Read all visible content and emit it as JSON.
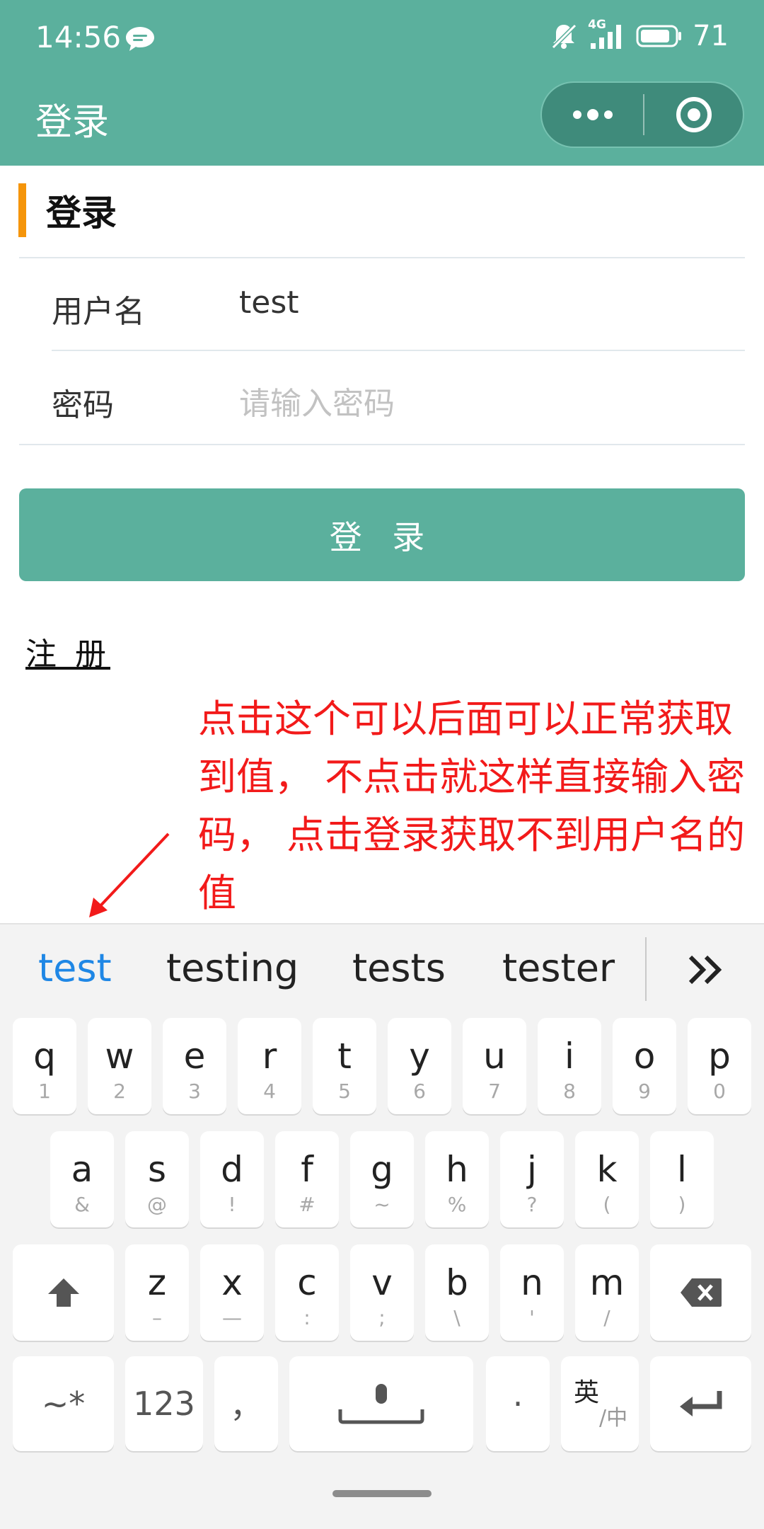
{
  "status_bar": {
    "time": "14:56",
    "signal_label": "4G",
    "battery": "71"
  },
  "nav": {
    "title": "登录"
  },
  "form": {
    "section_title": "登录",
    "username_label": "用户名",
    "username_value": "test",
    "password_label": "密码",
    "password_placeholder": "请输入密码",
    "login_button": "登 录",
    "register_link": "注 册"
  },
  "annotation": {
    "text": "点击这个可以后面可以正常获取到值， 不点击就这样直接输入密码， 点击登录获取不到用户名的值",
    "color": "#f21a1a"
  },
  "keyboard": {
    "suggestions": [
      "test",
      "testing",
      "tests",
      "tester"
    ],
    "row1": [
      {
        "key": "q",
        "sub": "1"
      },
      {
        "key": "w",
        "sub": "2"
      },
      {
        "key": "e",
        "sub": "3"
      },
      {
        "key": "r",
        "sub": "4"
      },
      {
        "key": "t",
        "sub": "5"
      },
      {
        "key": "y",
        "sub": "6"
      },
      {
        "key": "u",
        "sub": "7"
      },
      {
        "key": "i",
        "sub": "8"
      },
      {
        "key": "o",
        "sub": "9"
      },
      {
        "key": "p",
        "sub": "0"
      }
    ],
    "row2": [
      {
        "key": "a",
        "sub": "&"
      },
      {
        "key": "s",
        "sub": "@"
      },
      {
        "key": "d",
        "sub": "!"
      },
      {
        "key": "f",
        "sub": "#"
      },
      {
        "key": "g",
        "sub": "~"
      },
      {
        "key": "h",
        "sub": "%"
      },
      {
        "key": "j",
        "sub": "?"
      },
      {
        "key": "k",
        "sub": "("
      },
      {
        "key": "l",
        "sub": ")"
      }
    ],
    "row3": [
      {
        "key": "z",
        "sub": "–"
      },
      {
        "key": "x",
        "sub": "—"
      },
      {
        "key": "c",
        "sub": ":"
      },
      {
        "key": "v",
        "sub": ";"
      },
      {
        "key": "b",
        "sub": "\\"
      },
      {
        "key": "n",
        "sub": "'"
      },
      {
        "key": "m",
        "sub": "/"
      }
    ],
    "symbols_key": "~*",
    "numbers_key": "123",
    "comma_key": "，",
    "period_key": "·",
    "lang_key_main": "英",
    "lang_key_sub": "/中"
  },
  "colors": {
    "theme": "#5bb09d",
    "accent_bar": "#f5950a",
    "suggestion_active": "#1f87e5"
  }
}
